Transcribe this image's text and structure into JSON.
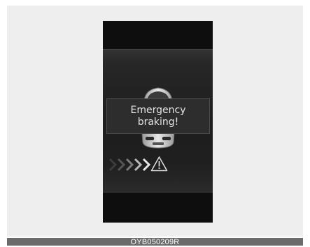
{
  "message": {
    "line1": "Emergency",
    "line2": "braking!"
  },
  "caption": "OYB050209R",
  "icons": {
    "car": "car-rear-view-icon",
    "chevrons": "approach-chevrons-icon",
    "warning": "warning-triangle-icon"
  },
  "colors": {
    "background": "#eeeeee",
    "display": "#0e0e0e",
    "popup": "#2d2d2d",
    "text": "#e4e4e4",
    "caption_bar": "#6b6b6b"
  }
}
